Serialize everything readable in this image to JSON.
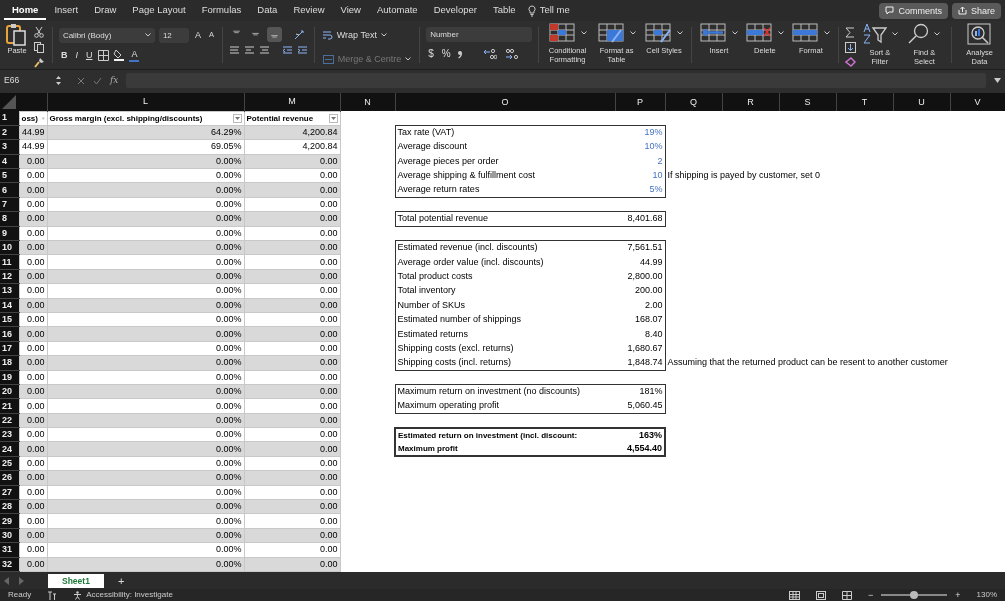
{
  "menu_tabs": [
    {
      "label": "Home",
      "selected": true
    },
    {
      "label": "Insert",
      "selected": false
    },
    {
      "label": "Draw",
      "selected": false
    },
    {
      "label": "Page Layout",
      "selected": false
    },
    {
      "label": "Formulas",
      "selected": false
    },
    {
      "label": "Data",
      "selected": false
    },
    {
      "label": "Review",
      "selected": false
    },
    {
      "label": "View",
      "selected": false
    },
    {
      "label": "Automate",
      "selected": false
    },
    {
      "label": "Developer",
      "selected": false
    },
    {
      "label": "Table",
      "selected": false
    }
  ],
  "tell_me": "Tell me",
  "comments_button": "Comments",
  "share_button": "Share",
  "ribbon": {
    "paste": "Paste",
    "font_name": "Calibri (Body)",
    "font_size": "12",
    "grow_font": "A",
    "shrink_font": "A",
    "bold": "B",
    "italic": "I",
    "underline": "U",
    "font_color": "A",
    "vertical_align": [
      {
        "selected": false
      },
      {
        "selected": false
      },
      {
        "selected": true
      }
    ],
    "wrap_text": {
      "label": "Wrap Text",
      "disabled": false
    },
    "merge_centre": {
      "label": "Merge & Centre",
      "disabled": true
    },
    "number_format": "Number",
    "currency": "$",
    "percent": "%",
    "large_buttons": [
      "Conditional Formatting",
      "Format as Table",
      "Cell Styles",
      "Insert",
      "Delete",
      "Format",
      "Sort & Filter",
      "Find & Select",
      "Analyse Data"
    ]
  },
  "formula_bar": {
    "name_box": "E66",
    "fx": "fx"
  },
  "columns": [
    "L",
    "M",
    "N",
    "O",
    "P",
    "Q",
    "R",
    "S",
    "T",
    "U",
    "V"
  ],
  "row_numbers": [
    "1",
    "2",
    "3",
    "4",
    "5",
    "6",
    "7",
    "8",
    "9",
    "10",
    "11",
    "12",
    "13",
    "14",
    "15",
    "16",
    "17",
    "18",
    "19",
    "20",
    "21",
    "22",
    "23",
    "24",
    "25",
    "26",
    "27",
    "28",
    "29",
    "30",
    "31",
    "32"
  ],
  "table": {
    "headers": [
      "oss)",
      "Gross margin (excl. shipping/discounts)",
      "Potential revenue"
    ],
    "rows": [
      [
        "44.99",
        "64.29%",
        "4,200.84"
      ],
      [
        "44.99",
        "69.05%",
        "4,200.84"
      ],
      [
        "0.00",
        "0.00%",
        "0.00"
      ],
      [
        "0.00",
        "0.00%",
        "0.00"
      ],
      [
        "0.00",
        "0.00%",
        "0.00"
      ],
      [
        "0.00",
        "0.00%",
        "0.00"
      ],
      [
        "0.00",
        "0.00%",
        "0.00"
      ],
      [
        "0.00",
        "0.00%",
        "0.00"
      ],
      [
        "0.00",
        "0.00%",
        "0.00"
      ],
      [
        "0.00",
        "0.00%",
        "0.00"
      ],
      [
        "0.00",
        "0.00%",
        "0.00"
      ],
      [
        "0.00",
        "0.00%",
        "0.00"
      ],
      [
        "0.00",
        "0.00%",
        "0.00"
      ],
      [
        "0.00",
        "0.00%",
        "0.00"
      ],
      [
        "0.00",
        "0.00%",
        "0.00"
      ],
      [
        "0.00",
        "0.00%",
        "0.00"
      ],
      [
        "0.00",
        "0.00%",
        "0.00"
      ],
      [
        "0.00",
        "0.00%",
        "0.00"
      ],
      [
        "0.00",
        "0.00%",
        "0.00"
      ],
      [
        "0.00",
        "0.00%",
        "0.00"
      ],
      [
        "0.00",
        "0.00%",
        "0.00"
      ],
      [
        "0.00",
        "0.00%",
        "0.00"
      ],
      [
        "0.00",
        "0.00%",
        "0.00"
      ],
      [
        "0.00",
        "0.00%",
        "0.00"
      ],
      [
        "0.00",
        "0.00%",
        "0.00"
      ],
      [
        "0.00",
        "0.00%",
        "0.00"
      ],
      [
        "0.00",
        "0.00%",
        "0.00"
      ],
      [
        "0.00",
        "0.00%",
        "0.00"
      ],
      [
        "0.00",
        "0.00%",
        "0.00"
      ],
      [
        "0.00",
        "0.00%",
        "0.00"
      ],
      [
        "0.00",
        "0.00%",
        "0.00"
      ]
    ]
  },
  "summary_groups": [
    {
      "kind": "input",
      "rows": [
        {
          "label": "Tax rate (VAT)",
          "value": "19%"
        },
        {
          "label": "Average discount",
          "value": "10%"
        },
        {
          "label": "Average pieces per order",
          "value": "2"
        },
        {
          "label": "Average shipping & fulfillment cost",
          "value": "10",
          "note": "If shipping is payed by customer, set 0"
        },
        {
          "label": "Average return rates",
          "value": "5%"
        }
      ]
    },
    {
      "kind": "plain",
      "rows": [
        {
          "label": "Total potential revenue",
          "value": "8,401.68"
        }
      ]
    },
    {
      "kind": "plain",
      "rows": [
        {
          "label": "Estimated revenue (incl. discounts)",
          "value": "7,561.51"
        },
        {
          "label": "Average order value (incl. discounts)",
          "value": "44.99"
        },
        {
          "label": "Total product costs",
          "value": "2,800.00"
        },
        {
          "label": "Total inventory",
          "value": "200.00"
        },
        {
          "label": "Number of SKUs",
          "value": "2.00"
        },
        {
          "label": "Estimated number of shippings",
          "value": "168.07"
        },
        {
          "label": "Estimated returns",
          "value": "8.40"
        },
        {
          "label": "Shipping costs (excl. returns)",
          "value": "1,680.67"
        },
        {
          "label": "Shipping costs (incl. returns)",
          "value": "1,848.74",
          "note": "Assuming that the returned product can be resent to another customer"
        }
      ]
    },
    {
      "kind": "plain",
      "rows": [
        {
          "label": "Maximum return on investment (no discounts)",
          "value": "181%"
        },
        {
          "label": "Maximum operating profit",
          "value": "5,060.45"
        }
      ]
    },
    {
      "kind": "bold",
      "rows": [
        {
          "label": "Estimated return on investment (incl. discount:",
          "value": "163%"
        },
        {
          "label": "Maximum profit",
          "value": "4,554.40"
        }
      ]
    }
  ],
  "sheet_tabs": [
    {
      "label": "Sheet1",
      "selected": true
    }
  ],
  "add_sheet": "+",
  "status_bar": {
    "ready": "Ready",
    "accessibility": "Accessibility: Investigate",
    "zoom_out": "−",
    "zoom_in": "+",
    "zoom": "130%",
    "level": 0.5
  }
}
